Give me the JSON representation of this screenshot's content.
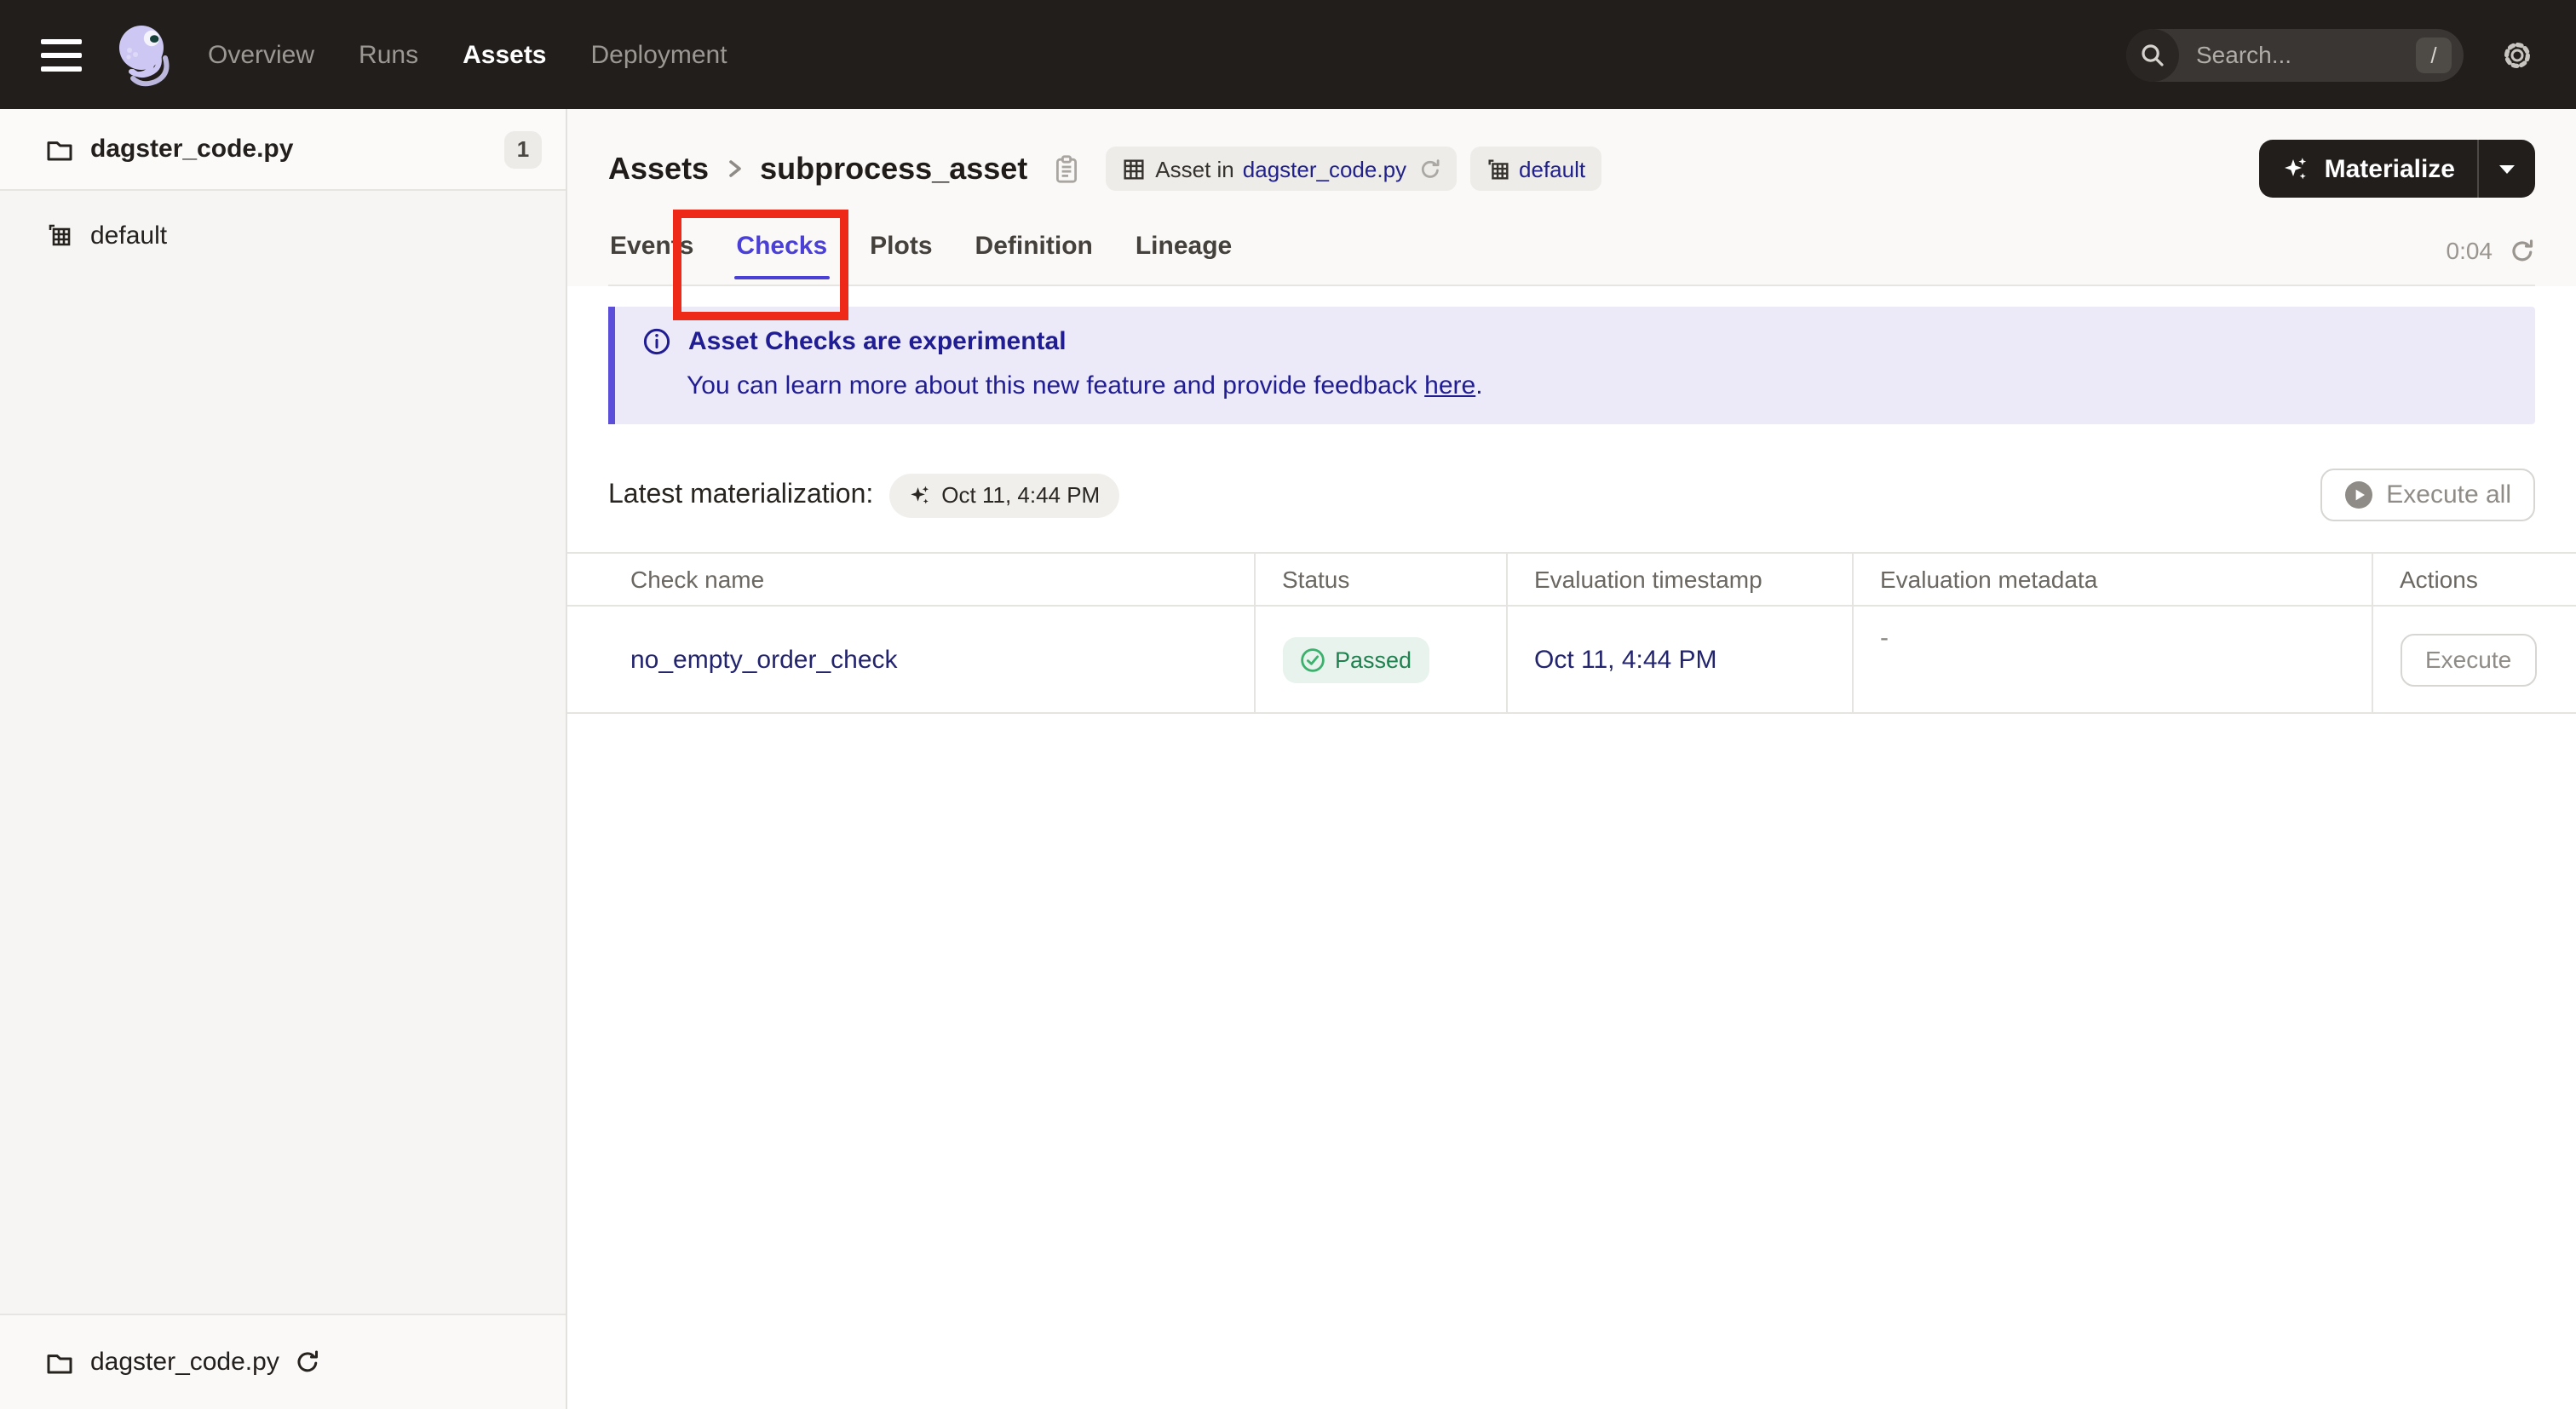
{
  "topnav": {
    "items": [
      {
        "label": "Overview",
        "active": false
      },
      {
        "label": "Runs",
        "active": false
      },
      {
        "label": "Assets",
        "active": true
      },
      {
        "label": "Deployment",
        "active": false
      }
    ],
    "search": {
      "placeholder": "Search...",
      "shortcut": "/"
    }
  },
  "sidebar": {
    "top_items": [
      {
        "icon": "folder-icon",
        "label": "dagster_code.py",
        "badge": "1"
      },
      {
        "icon": "asset-group-icon",
        "label": "default"
      }
    ],
    "bottom_item": {
      "icon": "folder-icon",
      "label": "dagster_code.py"
    }
  },
  "header": {
    "breadcrumb": {
      "root": "Assets",
      "current": "subprocess_asset"
    },
    "tags": [
      {
        "icon": "asset-table-icon",
        "prefix": "Asset in",
        "link": "dagster_code.py"
      },
      {
        "icon": "asset-group-icon",
        "link": "default"
      }
    ],
    "materialize": {
      "label": "Materialize"
    }
  },
  "tabs": {
    "items": [
      {
        "label": "Events",
        "active": false
      },
      {
        "label": "Checks",
        "active": true
      },
      {
        "label": "Plots",
        "active": false
      },
      {
        "label": "Definition",
        "active": false
      },
      {
        "label": "Lineage",
        "active": false
      }
    ],
    "timer": "0:04"
  },
  "banner": {
    "title": "Asset Checks are experimental",
    "body": "You can learn more about this new feature and provide feedback",
    "link": "here",
    "suffix": "."
  },
  "latest": {
    "label": "Latest materialization:",
    "value": "Oct 11, 4:44 PM"
  },
  "actions": {
    "execute_all": "Execute all"
  },
  "table": {
    "headers": [
      "Check name",
      "Status",
      "Evaluation timestamp",
      "Evaluation metadata",
      "Actions"
    ],
    "rows": [
      {
        "name": "no_empty_order_check",
        "status": "Passed",
        "timestamp": "Oct 11, 4:44 PM",
        "metadata": "-",
        "action": "Execute"
      }
    ]
  },
  "colors": {
    "nav_bg": "#221e1c",
    "accent_tab": "#4a3fd6",
    "banner_bg": "#eceaf8",
    "banner_border": "#5b4fd9",
    "banner_text": "#201d93",
    "link": "#21218b",
    "success_bg": "#e7f3ec",
    "success_text": "#1f8150",
    "annotation_red": "#ee2917"
  }
}
